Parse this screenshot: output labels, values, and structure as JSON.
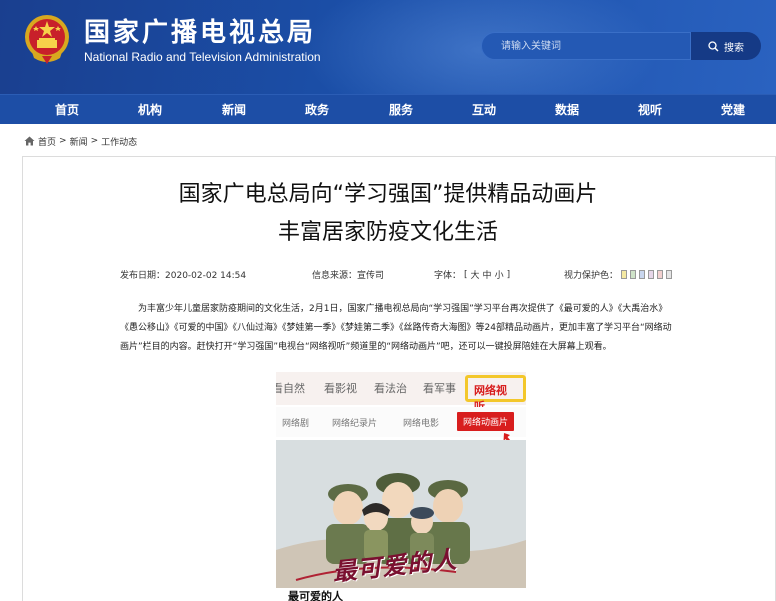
{
  "header": {
    "title_cn": "国家广播电视总局",
    "title_en": "National Radio and Television Administration",
    "search_placeholder": "请输入关键词",
    "search_button": "搜索"
  },
  "nav": {
    "items": [
      "首页",
      "机构",
      "新闻",
      "政务",
      "服务",
      "互动",
      "数据",
      "视听",
      "党建"
    ]
  },
  "breadcrumb": {
    "items": [
      "首页",
      "新闻",
      "工作动态"
    ],
    "separator": ">"
  },
  "article": {
    "headline_line1": "国家广电总局向“学习强国”提供精品动画片",
    "headline_line2": "丰富居家防疫文化生活",
    "publish_label": "发布日期：",
    "publish_date": "2020-02-02 14:54",
    "source_label": "信息来源：",
    "source": "宣传司",
    "font_label": "字体：",
    "font_open": "[",
    "font_sizes": [
      "大",
      "中",
      "小"
    ],
    "font_close": "]",
    "vision_label": "视力保护色：",
    "vision_colors": [
      "#f4e9a2",
      "#cfe3c8",
      "#c9d6ee",
      "#e6d6e8",
      "#f2d0cf",
      "#e4e4e4"
    ],
    "body": "为丰富少年儿童居家防疫期间的文化生活，2月1日，国家广播电视总局向“学习强国”学习平台再次提供了《最可爱的人》《大禹治水》《愚公移山》《可爱的中国》《八仙过海》《梦娃第一季》《梦娃第二季》《丝路传奇大海图》等24部精品动画片，更加丰富了学习平台“网络动画片”栏目的内容。赶快打开“学习强国”电视台“网络视听”频道里的“网络动画片”吧，还可以一键投屏陪娃在大屏幕上观看。"
  },
  "screenshot": {
    "tabs": [
      "看自然",
      "看影视",
      "看法治",
      "看军事",
      "网络视听"
    ],
    "active_tab": "网络视听",
    "subtabs": [
      "网络剧",
      "网络纪录片",
      "网络电影",
      "网络动画片"
    ],
    "active_subtab": "网络动画片",
    "poster_title": "最可爱的人",
    "caption": "最可爱的人",
    "highlight_color": "#f3c72b",
    "accent_color": "#d81e1e"
  },
  "colors": {
    "header_bg": "#1b4fa8",
    "nav_bg": "#1d4ea6"
  }
}
